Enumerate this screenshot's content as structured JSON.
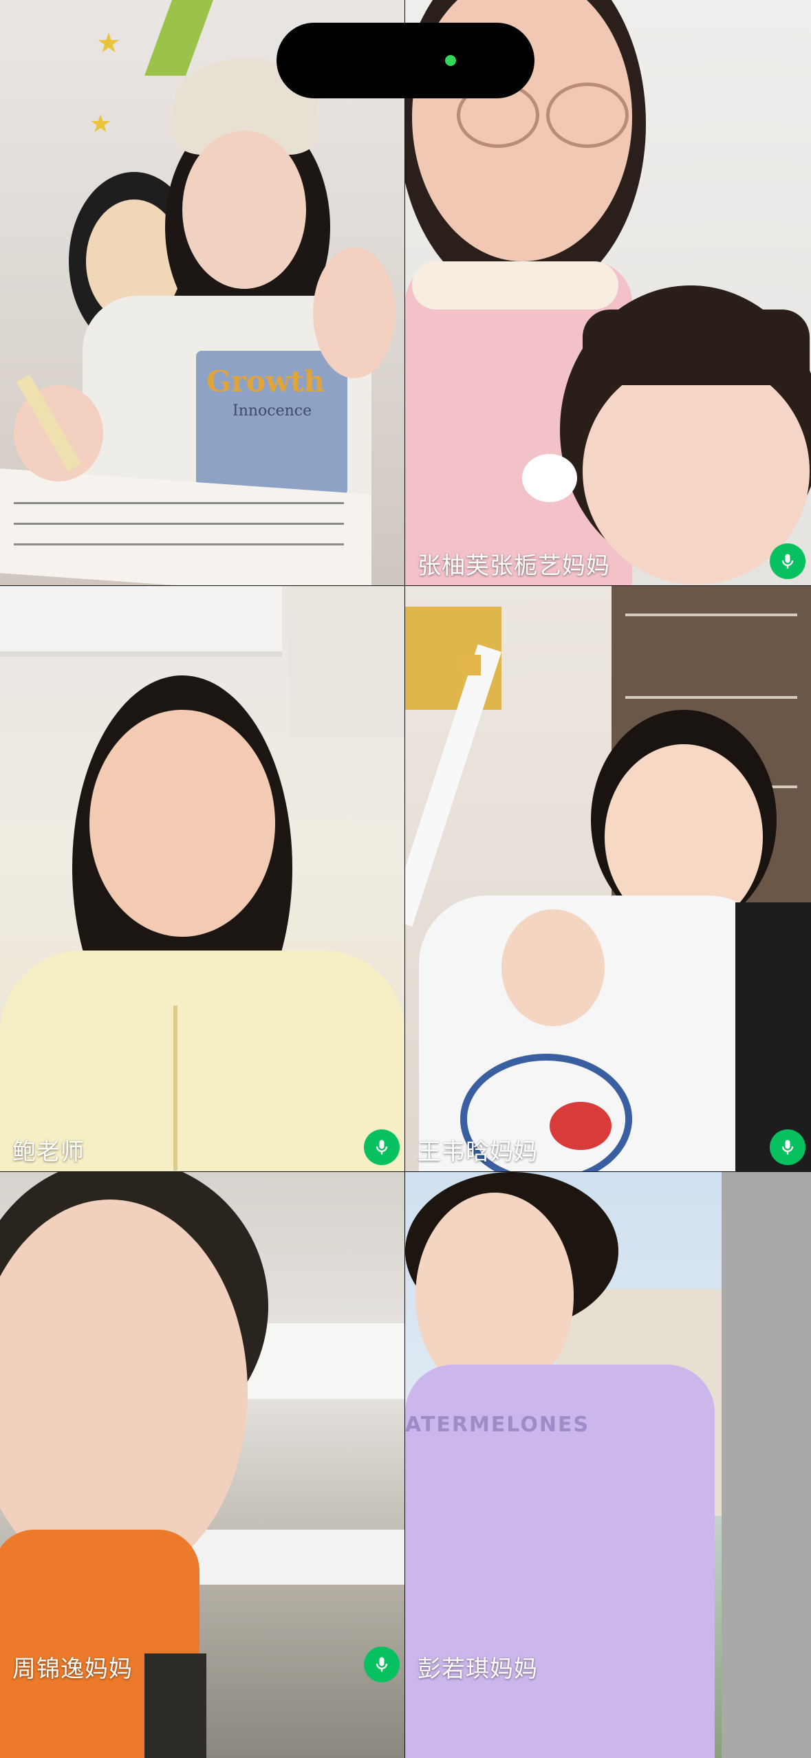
{
  "participants": [
    {
      "name": "",
      "show_mic": false
    },
    {
      "name": "张柚芙张栀艺妈妈",
      "show_mic": true
    },
    {
      "name": "鲍老师",
      "show_mic": true
    },
    {
      "name": "王韦晗妈妈",
      "show_mic": true
    },
    {
      "name": "周锦逸妈妈",
      "show_mic": true
    },
    {
      "name": "彭若琪妈妈",
      "show_mic": false
    }
  ],
  "shirt_text": {
    "tile1_line1": "Growth",
    "tile1_line2": "Innocence",
    "tile6": "ATERMELONES"
  },
  "colors": {
    "mic_bg": "#07c160",
    "indicator": "#35d45c"
  },
  "icons": {
    "mic": "microphone-icon"
  }
}
